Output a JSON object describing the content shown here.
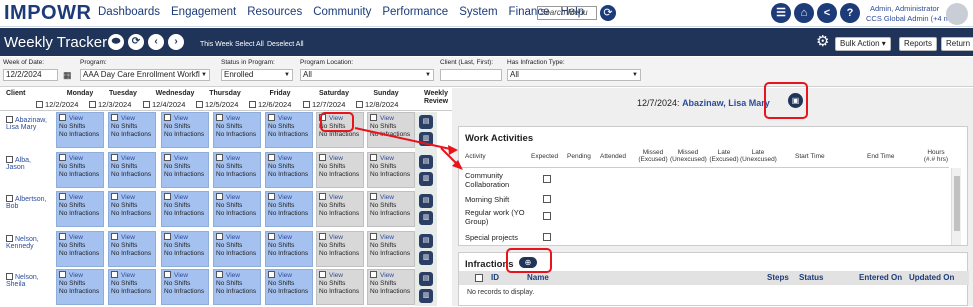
{
  "nav": {
    "logo": "IMPOWR",
    "links": [
      "Dashboards",
      "Engagement",
      "Resources",
      "Community",
      "Performance",
      "System",
      "Finance",
      "Help"
    ],
    "search_placeholder": "Search Menu",
    "user_name": "Admin, Administrator",
    "user_role": "CCS Global Admin (+4 more)"
  },
  "titlebar": {
    "title": "Weekly Tracker",
    "links": [
      "This Week",
      "Select All",
      "Deselect All"
    ],
    "buttons": [
      "Bulk Action",
      "Reports",
      "Return"
    ]
  },
  "filters": {
    "week_label": "Week of Date:",
    "week_value": "12/2/2024",
    "program_label": "Program:",
    "program_value": "AAA Day Care Enrollment Workfl",
    "status_label": "Status in Program:",
    "status_value": "Enrolled",
    "location_label": "Program Location:",
    "location_value": "All",
    "client_label": "Client (Last, First):",
    "client_value": "",
    "infraction_label": "Has Infraction Type:",
    "infraction_value": "All"
  },
  "grid": {
    "client_header": "Client",
    "weekly_review_header": "Weekly Review",
    "days": [
      {
        "name": "Monday",
        "date": "12/2/2024"
      },
      {
        "name": "Tuesday",
        "date": "12/3/2024"
      },
      {
        "name": "Wednesday",
        "date": "12/4/2024"
      },
      {
        "name": "Thursday",
        "date": "12/5/2024"
      },
      {
        "name": "Friday",
        "date": "12/6/2024"
      },
      {
        "name": "Saturday",
        "date": "12/7/2024"
      },
      {
        "name": "Sunday",
        "date": "12/8/2024"
      }
    ],
    "clients": [
      {
        "line1": "Abazinaw,",
        "line2": "Lisa Mary"
      },
      {
        "line1": "Alba,",
        "line2": "Jason"
      },
      {
        "line1": "Albertson,",
        "line2": "Bob"
      },
      {
        "line1": "Nelson,",
        "line2": "Kennedy"
      },
      {
        "line1": "Nelson,",
        "line2": "Sheila"
      }
    ],
    "cell_view": "View",
    "cell_shifts": "No Shifts",
    "cell_infractions": "No Infractions"
  },
  "detail": {
    "date": "12/7/2024:",
    "client": "Abazinaw, Lisa Mary"
  },
  "work_activities": {
    "title": "Work Activities",
    "columns": [
      "Activity",
      "Expected",
      "Pending",
      "Attended",
      "Missed (Excused)",
      "Missed (Unexcused)",
      "Late (Excused)",
      "Late (Unexcused)",
      "Start Time",
      "End Time",
      "Hours (#.# hrs)"
    ],
    "rows": [
      "Community Collaboration",
      "Morning Shift",
      "Regular work (YO Group)",
      "Special projects"
    ]
  },
  "infractions": {
    "title": "Infractions",
    "columns": [
      "ID",
      "Name",
      "Steps",
      "Status",
      "Entered On",
      "Updated On"
    ],
    "empty": "No records to display."
  },
  "colors": {
    "navy": "#1f3458",
    "cell_blue": "#a4c1ef",
    "cell_gray": "#d8d8d8",
    "highlight_red": "#e8141c"
  }
}
